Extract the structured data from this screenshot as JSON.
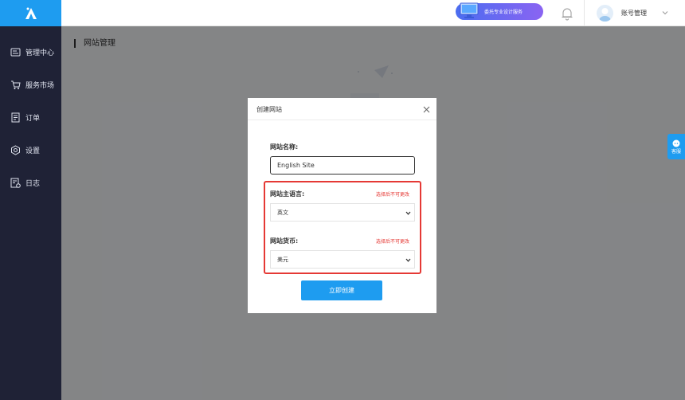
{
  "sidebar": {
    "items": [
      {
        "label": "管理中心",
        "icon": "dashboard-icon"
      },
      {
        "label": "服务市场",
        "icon": "cart-icon"
      },
      {
        "label": "订单",
        "icon": "order-icon"
      },
      {
        "label": "设置",
        "icon": "gear-icon"
      },
      {
        "label": "日志",
        "icon": "log-icon"
      }
    ]
  },
  "header": {
    "promo_text": "委托专业设计服务",
    "account_label": "账号管理"
  },
  "page": {
    "title": "网站管理"
  },
  "support": {
    "label": "客服"
  },
  "modal": {
    "title": "创建网站",
    "name_label": "网站名称:",
    "name_value": "English Site",
    "language_label": "网站主语言:",
    "language_hint": "选择后不可更改",
    "language_value": "英文",
    "currency_label": "网站货币:",
    "currency_hint": "选择后不可更改",
    "currency_value": "美元",
    "create_button": "立即创建"
  },
  "colors": {
    "accent": "#1e9cf0",
    "sidebar_bg": "#1f2236",
    "highlight": "#e53935"
  }
}
